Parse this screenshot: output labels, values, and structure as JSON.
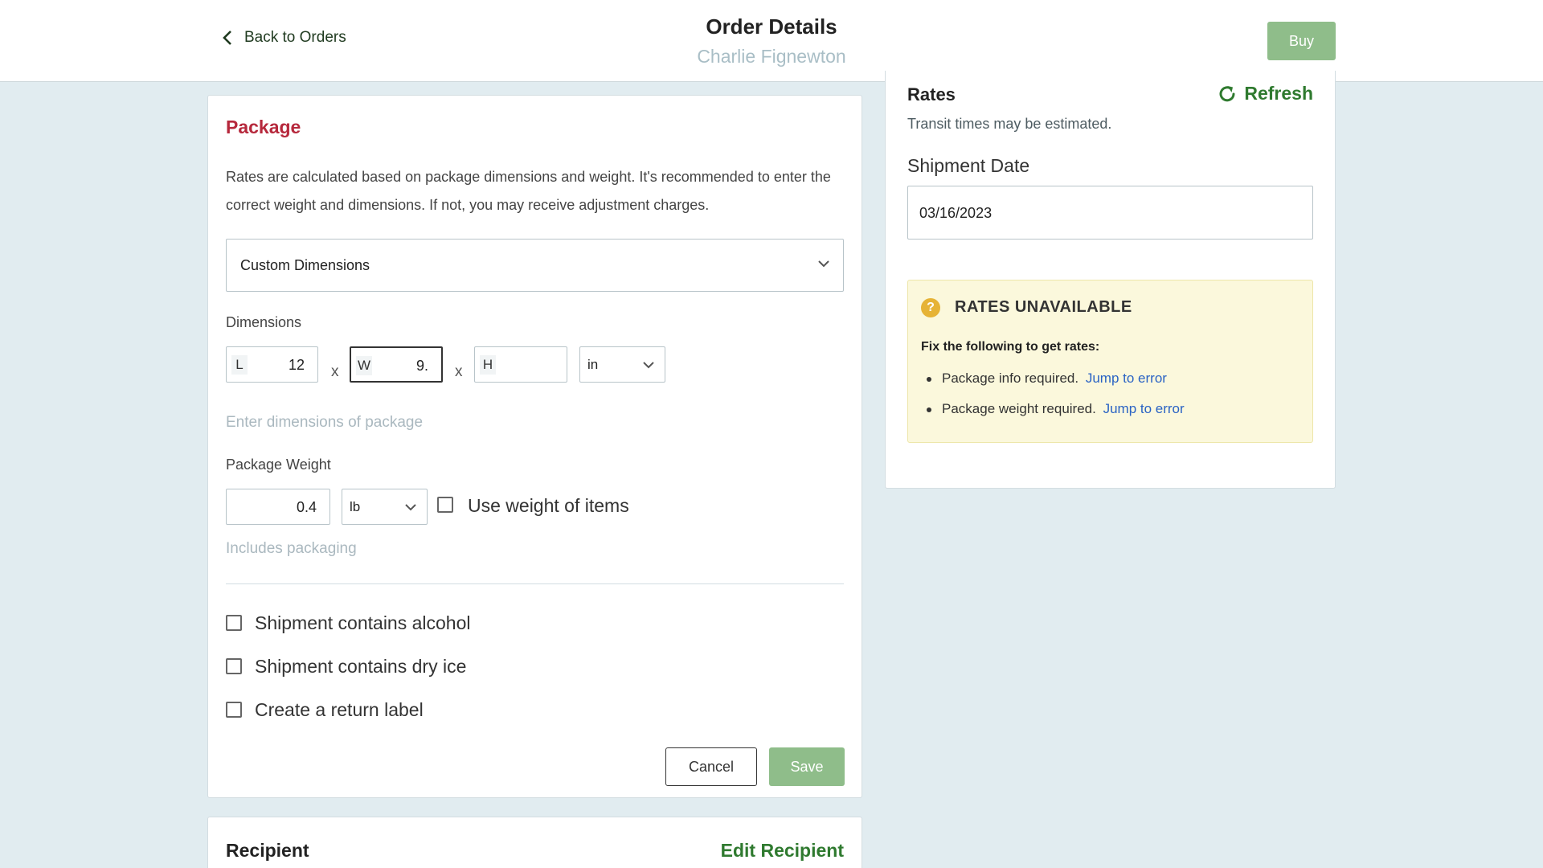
{
  "header": {
    "back_label": "Back to Orders",
    "title": "Order Details",
    "customer_name": "Charlie Fignewton",
    "buy_label": "Buy"
  },
  "package": {
    "title": "Package",
    "description": "Rates are calculated based on package dimensions and weight. It's recommended to enter the correct weight and dimensions. If not, you may receive adjustment charges.",
    "package_type": "Custom Dimensions",
    "dimensions_label": "Dimensions",
    "length_prefix": "L",
    "length_value": "12",
    "width_prefix": "W",
    "width_value": "9.",
    "height_prefix": "H",
    "height_value": "",
    "separator": "x",
    "dimension_unit": "in",
    "dimensions_hint": "Enter dimensions of package",
    "weight_label": "Package Weight",
    "weight_value": "0.4",
    "weight_unit": "lb",
    "use_weight_label": "Use weight of items",
    "weight_hint": "Includes packaging",
    "options": [
      {
        "label": "Shipment contains alcohol",
        "checked": false
      },
      {
        "label": "Shipment contains dry ice",
        "checked": false
      },
      {
        "label": "Create a return label",
        "checked": false
      }
    ],
    "cancel_label": "Cancel",
    "save_label": "Save"
  },
  "recipient": {
    "title": "Recipient",
    "edit_label": "Edit Recipient"
  },
  "rates": {
    "title": "Rates",
    "refresh_label": "Refresh",
    "transit_note": "Transit times may be estimated.",
    "shipment_date_label": "Shipment Date",
    "shipment_date": "03/16/2023",
    "alert": {
      "title": "RATES UNAVAILABLE",
      "fix_intro": "Fix the following to get rates:",
      "items": [
        {
          "text": "Package info required.",
          "link": "Jump to error"
        },
        {
          "text": "Package weight required.",
          "link": "Jump to error"
        }
      ]
    }
  },
  "colors": {
    "accent_green": "#2f7a2f",
    "button_green": "#8fbd8a",
    "package_red": "#b6283c",
    "link_blue": "#2a63c4",
    "alert_bg": "#fbf8dc"
  }
}
